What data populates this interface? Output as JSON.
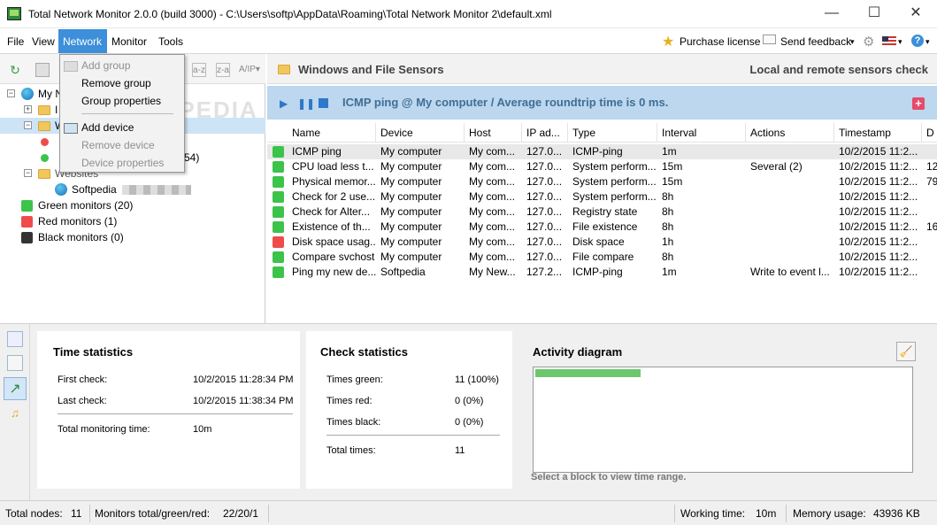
{
  "window": {
    "title": "Total Network Monitor 2.0.0 (build 3000) - C:\\Users\\softp\\AppData\\Roaming\\Total Network Monitor 2\\default.xml",
    "minimize": "—",
    "maximize": "☐",
    "close": "✕"
  },
  "menu": {
    "file": "File",
    "view": "View",
    "network": "Network",
    "monitor": "Monitor",
    "tools": "Tools",
    "purchase": "Purchase license",
    "feedback": "Send feedback",
    "feedback_arrow": "▾",
    "help": "?"
  },
  "watermark": "SOFTPEDIA",
  "network_menu": {
    "add_group": "Add group",
    "remove_group": "Remove group",
    "group_properties": "Group properties",
    "add_device": "Add device",
    "remove_device": "Remove device",
    "device_properties": "Device properties"
  },
  "tree": {
    "root": "My N",
    "item_i": "I",
    "item_w": "W",
    "item_54": "54)",
    "websites": "Websites",
    "softpedia": "Softpedia",
    "green": "Green monitors (20)",
    "red": "Red monitors (1)",
    "black": "Black monitors (0)"
  },
  "header": {
    "title": "Windows and File Sensors",
    "right": "Local and remote sensors check"
  },
  "sensor": {
    "text": "ICMP ping @ My computer /  Average roundtrip time is 0 ms.",
    "plus": "+"
  },
  "columns": [
    "Name",
    "Device",
    "Host",
    "IP ad...",
    "Type",
    "Interval",
    "Actions",
    "Timestamp",
    "D"
  ],
  "rows": [
    {
      "status": "green",
      "name": "ICMP ping",
      "device": "My computer",
      "host": "My com...",
      "ip": "127.0...",
      "type": "ICMP-ping",
      "interval": "1m",
      "actions": "",
      "timestamp": "10/2/2015 11:2...",
      "d": ""
    },
    {
      "status": "green",
      "name": "CPU load less t...",
      "device": "My computer",
      "host": "My com...",
      "ip": "127.0...",
      "type": "System perform...",
      "interval": "15m",
      "actions": "Several (2)",
      "timestamp": "10/2/2015 11:2...",
      "d": "12"
    },
    {
      "status": "green",
      "name": "Physical memor...",
      "device": "My computer",
      "host": "My com...",
      "ip": "127.0...",
      "type": "System perform...",
      "interval": "15m",
      "actions": "",
      "timestamp": "10/2/2015 11:2...",
      "d": "79"
    },
    {
      "status": "green",
      "name": "Check for 2 use...",
      "device": "My computer",
      "host": "My com...",
      "ip": "127.0...",
      "type": "System perform...",
      "interval": "8h",
      "actions": "",
      "timestamp": "10/2/2015 11:2...",
      "d": ""
    },
    {
      "status": "green",
      "name": "Check for Alter...",
      "device": "My computer",
      "host": "My com...",
      "ip": "127.0...",
      "type": "Registry state",
      "interval": "8h",
      "actions": "",
      "timestamp": "10/2/2015 11:2...",
      "d": ""
    },
    {
      "status": "green",
      "name": "Existence of th...",
      "device": "My computer",
      "host": "My com...",
      "ip": "127.0...",
      "type": "File existence",
      "interval": "8h",
      "actions": "",
      "timestamp": "10/2/2015 11:2...",
      "d": "16"
    },
    {
      "status": "red",
      "name": "Disk space usag...",
      "device": "My computer",
      "host": "My com...",
      "ip": "127.0...",
      "type": "Disk space",
      "interval": "1h",
      "actions": "",
      "timestamp": "10/2/2015 11:2...",
      "d": ""
    },
    {
      "status": "green",
      "name": "Compare svchost",
      "device": "My computer",
      "host": "My com...",
      "ip": "127.0...",
      "type": "File compare",
      "interval": "8h",
      "actions": "",
      "timestamp": "10/2/2015 11:2...",
      "d": ""
    },
    {
      "status": "green",
      "name": "Ping my new de...",
      "device": "Softpedia",
      "host": "My New...",
      "ip": "127.2...",
      "type": "ICMP-ping",
      "interval": "1m",
      "actions": "Write to event l...",
      "timestamp": "10/2/2015 11:2...",
      "d": ""
    }
  ],
  "time_stats": {
    "title": "Time statistics",
    "first_label": "First check:",
    "first_value": "10/2/2015 11:28:34 PM",
    "last_label": "Last check:",
    "last_value": "10/2/2015 11:38:34 PM",
    "total_label": "Total monitoring time:",
    "total_value": "10m"
  },
  "check_stats": {
    "title": "Check statistics",
    "green_label": "Times green:",
    "green_value": "11 (100%)",
    "red_label": "Times red:",
    "red_value": "0 (0%)",
    "black_label": "Times black:",
    "black_value": "0 (0%)",
    "total_label": "Total times:",
    "total_value": "11"
  },
  "activity": {
    "title": "Activity diagram",
    "hint": "Select a block to view time range.",
    "fill_fraction": 0.28
  },
  "status": {
    "nodes_label": "Total nodes:",
    "nodes_value": "11",
    "monitors_label": "Monitors total/green/red:",
    "monitors_value": "22/20/1",
    "working_label": "Working time:",
    "working_value": "10m",
    "memory_label": "Memory usage:",
    "memory_value": "43936 KB"
  },
  "colors": {
    "green": "#3cc34a",
    "red": "#ef4b4b",
    "black": "#333333",
    "accent": "#3c8fd8"
  }
}
